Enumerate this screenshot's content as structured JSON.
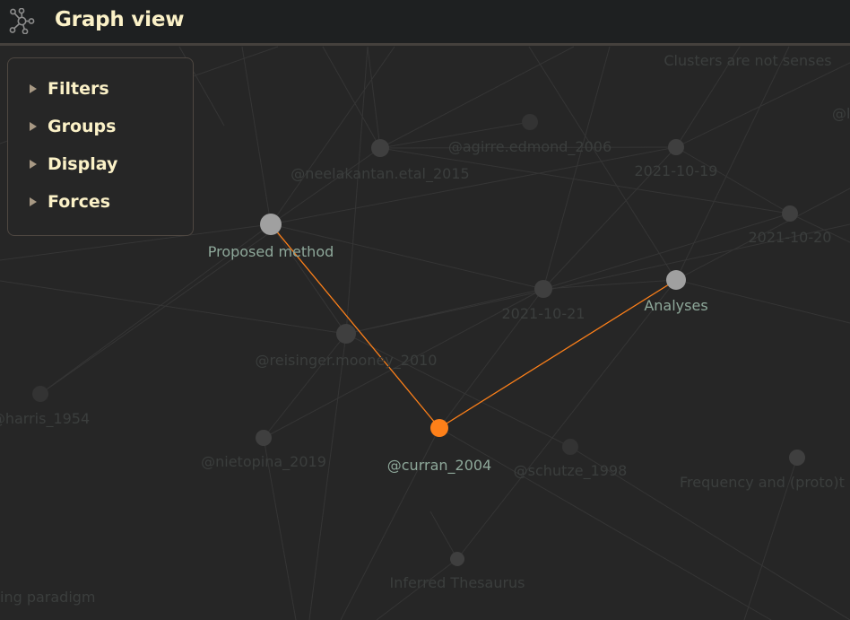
{
  "header": {
    "icon": "graph-icon",
    "title": "Graph view"
  },
  "panel": {
    "items": [
      {
        "label": "Filters",
        "icon": "triangle-right-icon",
        "expanded": false
      },
      {
        "label": "Groups",
        "icon": "triangle-right-icon",
        "expanded": false
      },
      {
        "label": "Display",
        "icon": "triangle-right-icon",
        "expanded": false
      },
      {
        "label": "Forces",
        "icon": "triangle-right-icon",
        "expanded": false
      }
    ]
  },
  "colors": {
    "background": "#262626",
    "titlebar": "#1e2021",
    "title_text": "#fbf1c7",
    "accent_orange": "#fe8019",
    "highlight_node": "#a0a0a0",
    "dim_node": "#3f3f3f",
    "highlight_label": "#8ea89a",
    "dim_label": "#3b3e3d",
    "edge": "#353535"
  },
  "graph": {
    "selected": "@curran_2004",
    "nodes": [
      {
        "id": "proposed",
        "label": "Proposed method",
        "state": "highlight"
      },
      {
        "id": "analyses",
        "label": "Analyses",
        "state": "highlight"
      },
      {
        "id": "curran",
        "label": "@curran_2004",
        "state": "active"
      },
      {
        "id": "neelakantan",
        "label": "@neelakantan.etal_2015",
        "state": "dim"
      },
      {
        "id": "agirre",
        "label": "@agirre.edmond_2006",
        "state": "dim"
      },
      {
        "id": "d1019",
        "label": "2021-10-19",
        "state": "dim"
      },
      {
        "id": "d1020",
        "label": "2021-10-20",
        "state": "dim"
      },
      {
        "id": "d1021",
        "label": "2021-10-21",
        "state": "dim"
      },
      {
        "id": "reisinger",
        "label": "@reisinger.mooney_2010",
        "state": "dim"
      },
      {
        "id": "harris",
        "label": "@harris_1954",
        "state": "dim"
      },
      {
        "id": "nietopina",
        "label": "@nietopina_2019",
        "state": "dim"
      },
      {
        "id": "schutze",
        "label": "@schutze_1998",
        "state": "dim"
      },
      {
        "id": "frequency",
        "label": "Frequency and (proto)t",
        "state": "dim"
      },
      {
        "id": "thesaurus",
        "label": "Inferred Thesaurus",
        "state": "dim"
      },
      {
        "id": "clusters",
        "label": "Clusters are not senses",
        "state": "dim"
      },
      {
        "id": "paradigm",
        "label": "ing paradigm",
        "state": "dim"
      },
      {
        "id": "at_partial",
        "label": "@l",
        "state": "dim"
      },
      {
        "id": "agirre_top",
        "label": "",
        "state": "dim"
      }
    ],
    "highlighted_edges": [
      {
        "from": "proposed",
        "to": "curran"
      },
      {
        "from": "analyses",
        "to": "curran"
      }
    ]
  }
}
